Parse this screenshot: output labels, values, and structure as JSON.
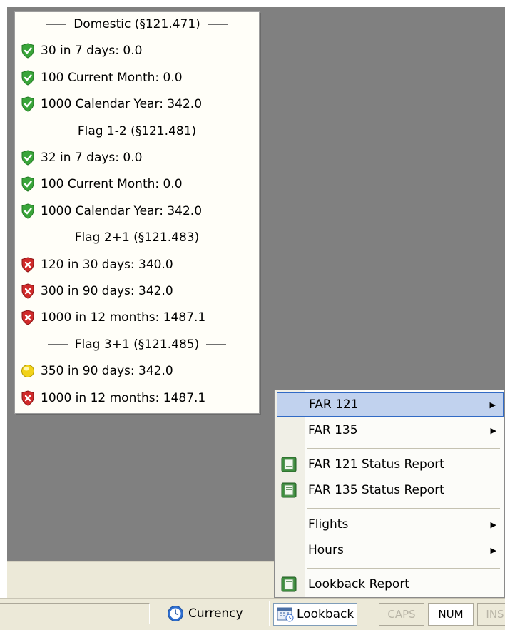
{
  "currency_panel": {
    "sections": [
      {
        "header": "Domestic (§121.471)",
        "items": [
          {
            "status": "ok",
            "text": "30 in 7 days: 0.0"
          },
          {
            "status": "ok",
            "text": "100 Current Month: 0.0"
          },
          {
            "status": "ok",
            "text": "1000 Calendar Year: 342.0"
          }
        ]
      },
      {
        "header": "Flag 1-2 (§121.481)",
        "items": [
          {
            "status": "ok",
            "text": "32 in 7 days: 0.0"
          },
          {
            "status": "ok",
            "text": "100 Current Month: 0.0"
          },
          {
            "status": "ok",
            "text": "1000 Calendar Year: 342.0"
          }
        ]
      },
      {
        "header": "Flag 2+1 (§121.483)",
        "items": [
          {
            "status": "error",
            "text": "120 in 30 days: 340.0"
          },
          {
            "status": "error",
            "text": "300 in 90 days: 342.0"
          },
          {
            "status": "error",
            "text": "1000 in 12 months: 1487.1"
          }
        ]
      },
      {
        "header": "Flag 3+1 (§121.485)",
        "items": [
          {
            "status": "warning",
            "text": "350 in 90 days: 342.0"
          },
          {
            "status": "error",
            "text": "1000 in 12 months: 1487.1"
          }
        ]
      }
    ],
    "status_icons": {
      "ok": "green-check-shield-icon",
      "error": "red-x-shield-icon",
      "warning": "yellow-warning-icon"
    },
    "colors": {
      "ok": "#3aa53a",
      "error": "#d02a2a",
      "warning": "#f2d21a"
    }
  },
  "context_menu": {
    "items": [
      {
        "label": "FAR 121",
        "submenu": true,
        "highlighted": true
      },
      {
        "label": "FAR 135",
        "submenu": true
      },
      {
        "separator": true
      },
      {
        "label": "FAR 121 Status Report",
        "icon": "report-icon"
      },
      {
        "label": "FAR 135 Status Report",
        "icon": "report-icon"
      },
      {
        "separator": true
      },
      {
        "label": "Flights",
        "submenu": true
      },
      {
        "label": "Hours",
        "submenu": true
      },
      {
        "separator": true
      },
      {
        "label": "Lookback Report",
        "icon": "report-icon"
      }
    ]
  },
  "status_bar": {
    "currency_label": "Currency",
    "lookback_label": "Lookback",
    "indicators": [
      {
        "label": "CAPS",
        "active": false
      },
      {
        "label": "NUM",
        "active": true
      },
      {
        "label": "INS",
        "active": false
      }
    ]
  }
}
